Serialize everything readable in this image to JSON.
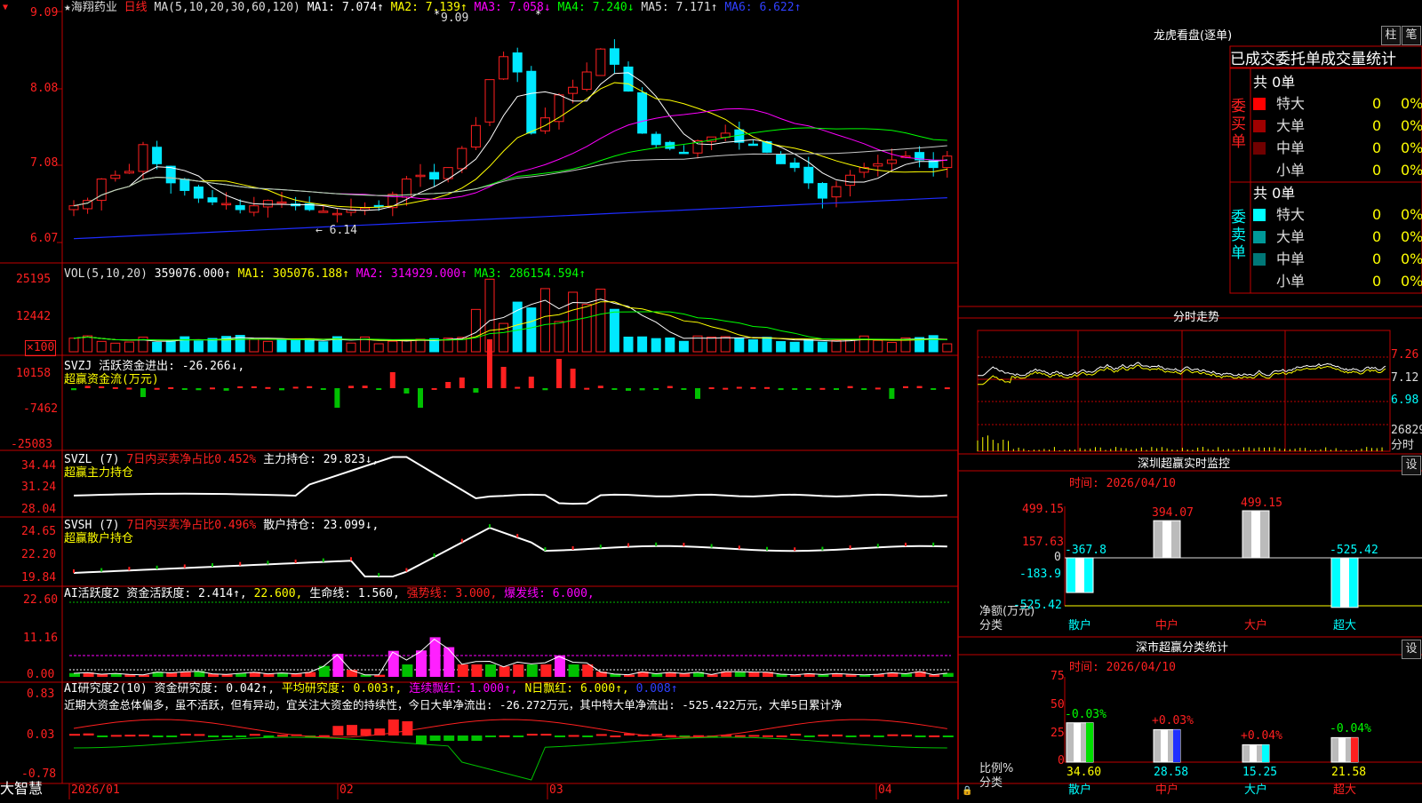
{
  "colors": {
    "up": "#ff2020",
    "down": "#00e8ff",
    "frame": "#c00000",
    "ma1": "#ffffff",
    "ma2": "#ffff00",
    "ma3": "#ff00ff",
    "ma4": "#00ff00",
    "ma5": "#c8c8c8",
    "ma6": "#1e2cff"
  },
  "stock": {
    "name": "★海翔药业",
    "period": "日线"
  },
  "main_header": {
    "ma": "MA(5,10,20,30,60,120)",
    "ma1": "MA1: 7.074↑",
    "ma2": "MA2: 7.139↑",
    "ma3": "MA3: 7.058↓",
    "ma4": "MA4: 7.240↓",
    "ma5": "MA5: 7.171↑",
    "ma6": "MA6: 6.622↑"
  },
  "price_axis": [
    "9.09",
    "8.08",
    "7.08",
    "6.07"
  ],
  "price_marks": {
    "high": "9.09",
    "low": "6.14"
  },
  "vol": {
    "header": "VOL(5,10,20)",
    "value": "359076.000↑",
    "ma1": "MA1: 305076.188↑",
    "ma2": "MA2: 314929.000↑",
    "ma3": "MA3: 286154.594↑",
    "axis": [
      "25195",
      "12442",
      "×100"
    ]
  },
  "svzj": {
    "header": "SVZJ  活跃资金进出: -26.266↓,",
    "sub": "超赢资金流(万元)",
    "axis": [
      "10158",
      "-7462",
      "-25083"
    ]
  },
  "svzl": {
    "header": "SVZL (7)",
    "mid": "7日内买卖净占比0.452%",
    "main": "主力持仓: 29.823↓,",
    "sub": "超赢主力持仓",
    "axis": [
      "34.44",
      "31.24",
      "28.04"
    ]
  },
  "svsh": {
    "header": "SVSH (7)",
    "mid": "7日内买卖净占比0.496%",
    "main": "散户持仓: 23.099↓,",
    "sub": "超赢散户持仓",
    "axis": [
      "24.65",
      "22.20",
      "19.84"
    ]
  },
  "ai1": {
    "name": "AI活跃度2",
    "a": "资金活跃度: 2.414↑,",
    "b": "22.600,",
    "c": "生命线: 1.560,",
    "d": "强势线: 3.000,",
    "e": "爆发线: 6.000,",
    "axis": [
      "22.60",
      "11.16",
      "0.00"
    ]
  },
  "ai2": {
    "name": "AI研究度2(10)",
    "a": "资金研究度: 0.042↑,",
    "b": "平均研究度: 0.003↑,",
    "c": "连续飘红: 1.000↑,",
    "d": "N日飘红: 6.000↑,",
    "e": "0.008↑",
    "text": "近期大资金总体偏多，虽不活跃，但有异动，宜关注大资金的持续性，今日大单净流出: -26.272万元，其中特大单净流出: -525.422万元，大单5日累计净",
    "axis": [
      "0.83",
      "0.03",
      "-0.78"
    ]
  },
  "dates": [
    "2026/01",
    "02",
    "03",
    "04"
  ],
  "brand": "大智慧",
  "lhb": {
    "title": "龙虎看盘(逐单)",
    "btn1": "柱",
    "btn2": "笔",
    "subtitle": "已成交委托单成交量统计",
    "buy_label": "委买单",
    "sell_label": "委卖单",
    "buy_total": "共 0单",
    "sell_total": "共 0单",
    "buy_rows": [
      {
        "name": "特大",
        "count": "0",
        "pct": "0%",
        "color": "#ff0000"
      },
      {
        "name": "大单",
        "count": "0",
        "pct": "0%",
        "color": "#a00000"
      },
      {
        "name": "中单",
        "count": "0",
        "pct": "0%",
        "color": "#700000"
      },
      {
        "name": "小单",
        "count": "0",
        "pct": "0%",
        "color": "#000000"
      }
    ],
    "sell_rows": [
      {
        "name": "特大",
        "count": "0",
        "pct": "0%",
        "color": "#00ffff"
      },
      {
        "name": "大单",
        "count": "0",
        "pct": "0%",
        "color": "#009999"
      },
      {
        "name": "中单",
        "count": "0",
        "pct": "0%",
        "color": "#007777"
      },
      {
        "name": "小单",
        "count": "0",
        "pct": "0%",
        "color": "#000000"
      }
    ]
  },
  "intraday": {
    "title": "分时走势",
    "axis": [
      "7.26",
      "7.12",
      "6.98",
      "26829"
    ],
    "unit": "分时"
  },
  "monitor": {
    "title": "深圳超赢实时监控",
    "btn": "设",
    "time": "时间: 2026/04/10",
    "axis": [
      "499.15",
      "157.63",
      "0",
      "-183.9",
      "-525.42"
    ],
    "axis_label1": "净额(万元)",
    "axis_label2": "分类",
    "bars": [
      {
        "cat": "散户",
        "value": -367.8,
        "label": "-367.8"
      },
      {
        "cat": "中户",
        "value": 394.07,
        "label": "394.07"
      },
      {
        "cat": "大户",
        "value": 499.15,
        "label": "499.15"
      },
      {
        "cat": "超大",
        "value": -525.42,
        "label": "-525.42"
      }
    ]
  },
  "classify": {
    "title": "深市超赢分类统计",
    "btn": "设",
    "time": "时间: 2026/04/10",
    "axis": [
      "75",
      "50",
      "25",
      "0"
    ],
    "axis_label1": "比例%",
    "axis_label2": "分类",
    "bars": [
      {
        "cat": "散户",
        "value": 34.6,
        "label": "34.60",
        "delta": "-0.03%",
        "color": "#00e000"
      },
      {
        "cat": "中户",
        "value": 28.58,
        "label": "28.58",
        "delta": "+0.03%",
        "color": "#2030ff"
      },
      {
        "cat": "大户",
        "value": 15.25,
        "label": "15.25",
        "delta": "+0.04%",
        "color": "#00ffff"
      },
      {
        "cat": "超大",
        "value": 21.58,
        "label": "21.58",
        "delta": "-0.04%",
        "color": "#ff2020"
      }
    ]
  }
}
